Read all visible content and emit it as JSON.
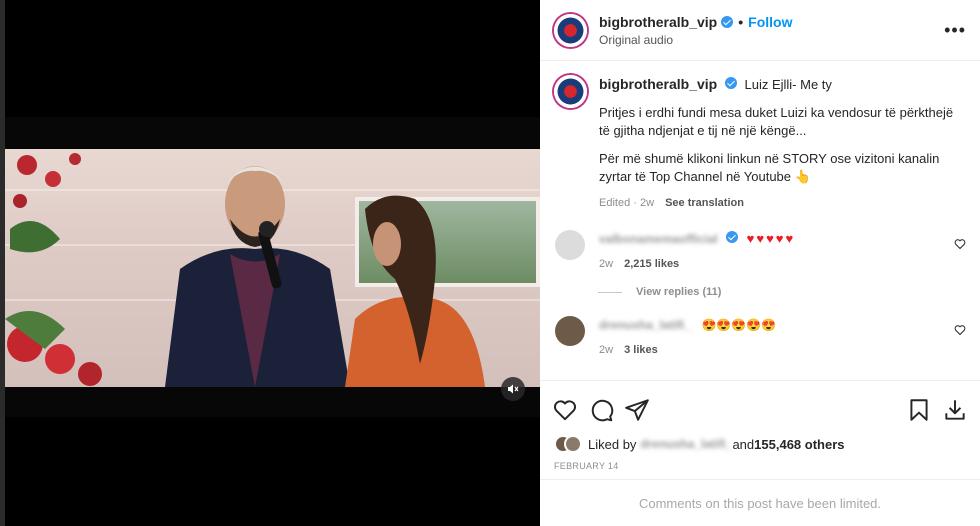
{
  "post": {
    "username": "bigbrotheralb_vip",
    "follow_label": "Follow",
    "separator": "•",
    "subtitle": "Original audio",
    "more_icon": "more-horizontal-icon"
  },
  "caption": {
    "username": "bigbrotheralb_vip",
    "title": "Luiz Ejlli- Me ty",
    "paragraph1": "Pritjes i erdhi fundi mesa duket Luizi ka vendosur të përkthejë të gjitha ndjenjat e tij në një këngë...",
    "paragraph2": "Për më shumë klikoni linkun në STORY ose vizitoni kanalin zyrtar të Top Channel në Youtube 👆",
    "edited": "Edited · 2w",
    "see_translation": "See translation"
  },
  "comments": [
    {
      "username": "valbonamemaofficial",
      "text": "♥♥♥♥♥",
      "age": "2w",
      "likes": "2,215 likes",
      "avatar_color": "#d8d8d8",
      "verified": true
    },
    {
      "username": "drenusha_latifi_",
      "text": "😍😍😍😍😍",
      "age": "2w",
      "likes": "3 likes",
      "avatar_color": "#6e5a48"
    }
  ],
  "view_replies": "View replies (11)",
  "likes": {
    "prefix": "Liked by ",
    "user": "drenusha_latifi_",
    "middle": " and ",
    "count": "155,468 others"
  },
  "date": "FEBRUARY 14",
  "limited_notice": "Comments on this post have been limited.",
  "colors": {
    "accent": "#0095f6",
    "verified": "#3897f0",
    "heart": "#ed1c24",
    "muted": "#8e8e8e"
  }
}
